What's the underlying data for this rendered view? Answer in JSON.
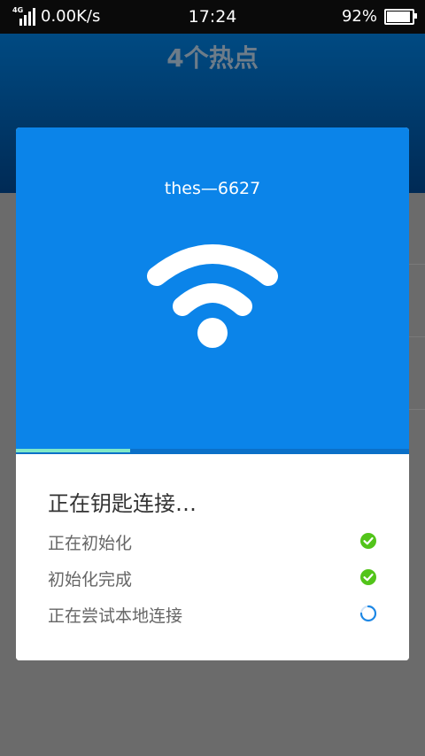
{
  "status_bar": {
    "network_type": "4G",
    "speed": "0.00K/s",
    "time": "17:24",
    "battery_text": "92%",
    "battery_level": 0.92
  },
  "background": {
    "title": "4个热点"
  },
  "dialog": {
    "ssid": "thes—6627",
    "progress": 0.29,
    "heading": "正在钥匙连接…",
    "steps": [
      {
        "label": "正在初始化",
        "status": "done"
      },
      {
        "label": "初始化完成",
        "status": "done"
      },
      {
        "label": "正在尝试本地连接",
        "status": "loading"
      }
    ]
  },
  "colors": {
    "dialog_blue": "#0b84e9",
    "progress": "#7fe8c8",
    "check_green": "#52c41a",
    "spinner_blue": "#1e88e5"
  }
}
